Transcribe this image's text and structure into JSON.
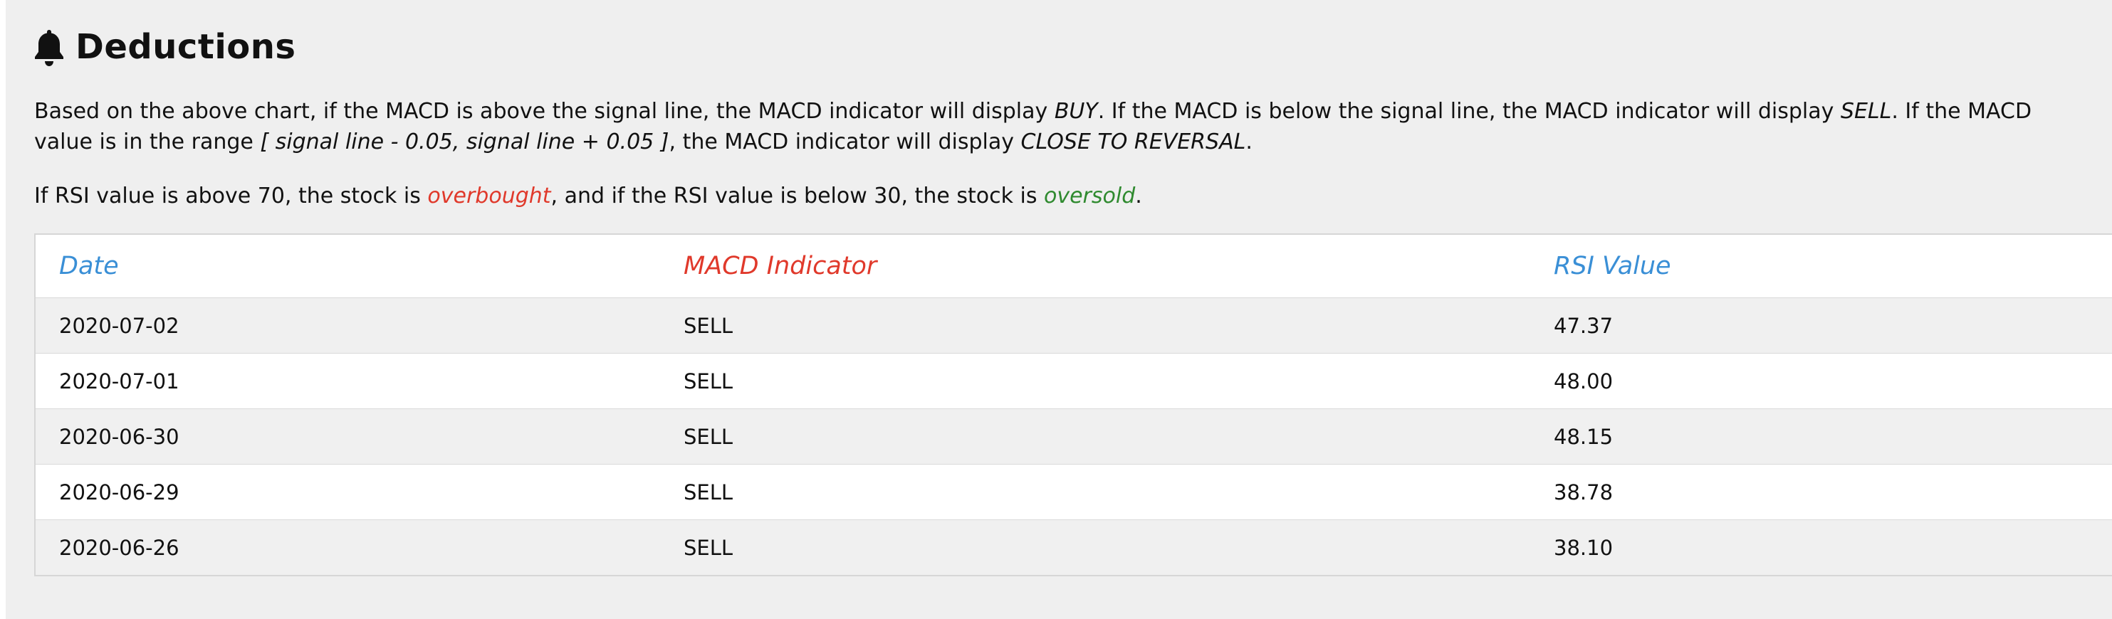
{
  "section": {
    "title": "Deductions",
    "icon": "bell-icon"
  },
  "paragraph1": {
    "t1": "Based on the above chart, if the MACD is above the signal line, the MACD indicator will display ",
    "buy": "BUY",
    "t2": ". If the MACD is below the signal line, the MACD indicator will display ",
    "sell": "SELL",
    "t3": ". If the MACD value is in the range ",
    "range": "[ signal line - 0.05, signal line + 0.05 ]",
    "t4": ", the MACD indicator will display ",
    "reversal": "CLOSE TO REVERSAL",
    "t5": "."
  },
  "paragraph2": {
    "t1": "If RSI value is above 70, the stock is ",
    "overbought": "overbought",
    "t2": ", and if the RSI value is below 30, the stock is ",
    "oversold": "oversold",
    "t3": "."
  },
  "colors": {
    "overbought": "#e0392b",
    "oversold": "#2f8a2f",
    "header_blue": "#3a8fd6",
    "header_red": "#e0392b"
  },
  "table": {
    "headers": [
      "Date",
      "MACD Indicator",
      "RSI Value"
    ],
    "rows": [
      [
        "2020-07-02",
        "SELL",
        "47.37"
      ],
      [
        "2020-07-01",
        "SELL",
        "48.00"
      ],
      [
        "2020-06-30",
        "SELL",
        "48.15"
      ],
      [
        "2020-06-29",
        "SELL",
        "38.78"
      ],
      [
        "2020-06-26",
        "SELL",
        "38.10"
      ]
    ]
  }
}
